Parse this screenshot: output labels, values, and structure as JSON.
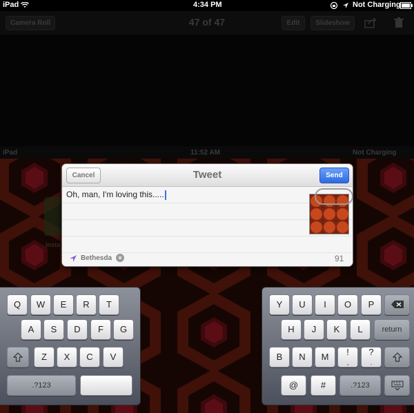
{
  "status_bar": {
    "device": "iPad",
    "time": "4:34 PM",
    "battery_text": "Not Charging"
  },
  "photo_toolbar": {
    "camera_roll": "Camera Roll",
    "counter": "47 of 47",
    "edit": "Edit",
    "slideshow": "Slideshow"
  },
  "embedded_status": {
    "device": "iPad",
    "time": "11:52 AM",
    "battery_text": "Not Charging"
  },
  "embedded_label": "Insta",
  "tweet_sheet": {
    "cancel": "Cancel",
    "title": "Tweet",
    "send": "Send",
    "text": "Oh, man, I'm loving this.....",
    "location": "Bethesda",
    "char_count": "91"
  },
  "keyboard": {
    "left_rows": [
      [
        "Q",
        "W",
        "E",
        "R",
        "T"
      ],
      [
        "A",
        "S",
        "D",
        "F",
        "G"
      ],
      [
        "Z",
        "X",
        "C",
        "V"
      ]
    ],
    "right_rows": [
      [
        "Y",
        "U",
        "I",
        "O",
        "P"
      ],
      [
        "H",
        "J",
        "K",
        "L"
      ],
      [
        "B",
        "N",
        "M",
        "!",
        "?"
      ]
    ],
    "numbers_left": ".?123",
    "numbers_right": ".?123",
    "return": "return",
    "at": "@",
    "hash": "#",
    "right_row3_alt": [
      "!",
      "?"
    ],
    "right_row3_alt_small": [
      ",",
      "."
    ]
  },
  "colors": {
    "send_blue": "#2d6ae3",
    "caret_blue": "#3b6ee6"
  },
  "icons": [
    "wifi-icon",
    "location-arrow-icon",
    "rotation-lock-icon",
    "battery-icon",
    "share-icon",
    "trash-icon",
    "shift-icon",
    "backspace-icon",
    "keyboard-dismiss-icon",
    "clear-location-icon"
  ]
}
